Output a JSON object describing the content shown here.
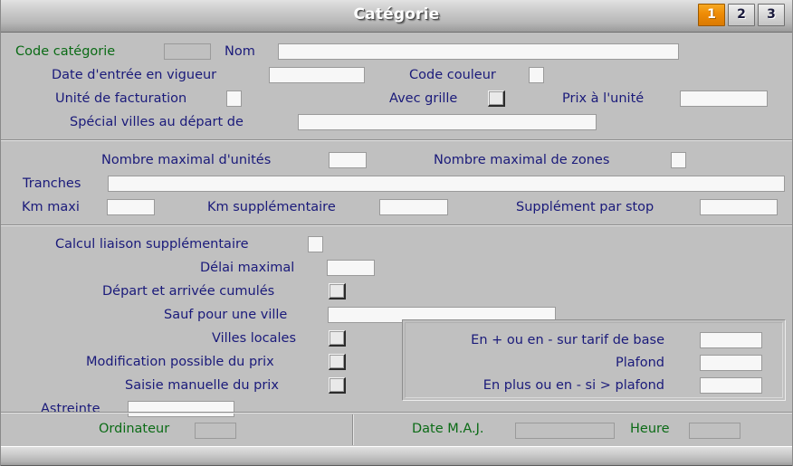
{
  "window": {
    "title": "Catégorie",
    "tabs": [
      {
        "label": "1",
        "active": true
      },
      {
        "label": "2",
        "active": false
      },
      {
        "label": "3",
        "active": false
      }
    ],
    "accent_active_tab": "#ee8b06",
    "label_color": "#1a1a7a",
    "key_label_color": "#0b6b16",
    "background": "#c0c0c0"
  },
  "section1": {
    "code_categorie_label": "Code catégorie",
    "code_categorie_value": "",
    "nom_label": "Nom",
    "nom_value": "",
    "date_entree_label": "Date d'entrée en vigueur",
    "date_entree_value": "",
    "code_couleur_label": "Code couleur",
    "code_couleur_value": "",
    "unite_facturation_label": "Unité de facturation",
    "unite_facturation_value": "",
    "avec_grille_label": "Avec grille",
    "avec_grille_checked": false,
    "prix_unite_label": "Prix à l'unité",
    "prix_unite_value": "",
    "special_villes_label": "Spécial villes au départ de",
    "special_villes_value": ""
  },
  "section2": {
    "nombre_max_unites_label": "Nombre maximal d'unités",
    "nombre_max_unites_value": "",
    "nombre_max_zones_label": "Nombre maximal de zones",
    "nombre_max_zones_value": "",
    "tranches_label": "Tranches",
    "tranches_value": "",
    "km_maxi_label": "Km maxi",
    "km_maxi_value": "",
    "km_supplementaire_label": "Km supplémentaire",
    "km_supplementaire_value": "",
    "supplement_stop_label": "Supplément par stop",
    "supplement_stop_value": ""
  },
  "section3": {
    "calcul_liaison_label": "Calcul liaison supplémentaire",
    "calcul_liaison_value": "",
    "delai_maximal_label": "Délai maximal",
    "delai_maximal_value": "",
    "depart_arrivee_label": "Départ et arrivée cumulés",
    "depart_arrivee_checked": false,
    "sauf_ville_label": "Sauf pour une ville",
    "sauf_ville_value": "",
    "villes_locales_label": "Villes locales",
    "villes_locales_checked": false,
    "modification_prix_label": "Modification possible du prix",
    "modification_prix_checked": false,
    "saisie_manuelle_label": "Saisie manuelle du prix",
    "saisie_manuelle_checked": false,
    "astreinte_label": "Astreinte",
    "astreinte_value": "",
    "tarif_panel": {
      "en_plus_moins_label": "En + ou en - sur tarif de base",
      "en_plus_moins_value": "",
      "plafond_label": "Plafond",
      "plafond_value": "",
      "en_plus_si_plafond_label": "En plus ou en - si > plafond",
      "en_plus_si_plafond_value": ""
    }
  },
  "statusbar": {
    "ordinateur_label": "Ordinateur",
    "ordinateur_value": "",
    "date_maj_label": "Date M.A.J.",
    "date_maj_value": "",
    "heure_label": "Heure",
    "heure_value": ""
  }
}
